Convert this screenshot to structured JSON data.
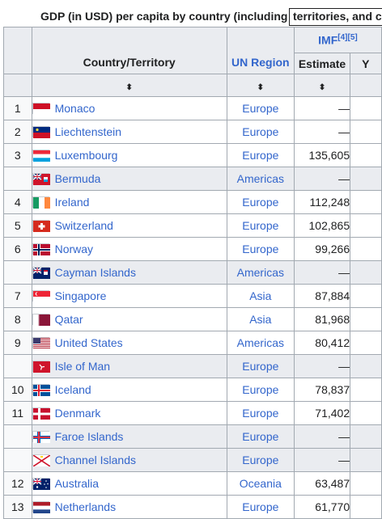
{
  "caption": {
    "prefix": "GDP (in USD) per capita by country (including",
    "link": "territories, and c"
  },
  "header": {
    "country": "Country/Territory",
    "region": "UN Region",
    "imf": "IMF",
    "imf_refs": "[4][5]",
    "estimate": "Estimate",
    "year_partial": "Y",
    "sort_icon": "⬍"
  },
  "rows": [
    {
      "rank": "1",
      "country": "Monaco",
      "region": "Europe",
      "estimate": "—",
      "shaded": false
    },
    {
      "rank": "2",
      "country": "Liechtenstein",
      "region": "Europe",
      "estimate": "—",
      "shaded": false
    },
    {
      "rank": "3",
      "country": "Luxembourg",
      "region": "Europe",
      "estimate": "135,605",
      "shaded": false
    },
    {
      "rank": "",
      "country": "Bermuda",
      "region": "Americas",
      "estimate": "—",
      "shaded": true
    },
    {
      "rank": "4",
      "country": "Ireland",
      "region": "Europe",
      "estimate": "112,248",
      "shaded": false
    },
    {
      "rank": "5",
      "country": "Switzerland",
      "region": "Europe",
      "estimate": "102,865",
      "shaded": false
    },
    {
      "rank": "6",
      "country": "Norway",
      "region": "Europe",
      "estimate": "99,266",
      "shaded": false
    },
    {
      "rank": "",
      "country": "Cayman Islands",
      "region": "Americas",
      "estimate": "—",
      "shaded": true
    },
    {
      "rank": "7",
      "country": "Singapore",
      "region": "Asia",
      "estimate": "87,884",
      "shaded": false
    },
    {
      "rank": "8",
      "country": "Qatar",
      "region": "Asia",
      "estimate": "81,968",
      "shaded": false
    },
    {
      "rank": "9",
      "country": "United States",
      "region": "Americas",
      "estimate": "80,412",
      "shaded": false
    },
    {
      "rank": "",
      "country": "Isle of Man",
      "region": "Europe",
      "estimate": "—",
      "shaded": true
    },
    {
      "rank": "10",
      "country": "Iceland",
      "region": "Europe",
      "estimate": "78,837",
      "shaded": false
    },
    {
      "rank": "11",
      "country": "Denmark",
      "region": "Europe",
      "estimate": "71,402",
      "shaded": false
    },
    {
      "rank": "",
      "country": "Faroe Islands",
      "region": "Europe",
      "estimate": "—",
      "shaded": true
    },
    {
      "rank": "",
      "country": "Channel Islands",
      "region": "Europe",
      "estimate": "—",
      "shaded": true
    },
    {
      "rank": "12",
      "country": "Australia",
      "region": "Oceania",
      "estimate": "63,487",
      "shaded": false
    },
    {
      "rank": "13",
      "country": "Netherlands",
      "region": "Europe",
      "estimate": "61,770",
      "shaded": false
    }
  ],
  "flags": {
    "Monaco": "monaco-flag-icon",
    "Liechtenstein": "liechtenstein-flag-icon",
    "Luxembourg": "luxembourg-flag-icon",
    "Bermuda": "bermuda-flag-icon",
    "Ireland": "ireland-flag-icon",
    "Switzerland": "switzerland-flag-icon",
    "Norway": "norway-flag-icon",
    "Cayman Islands": "cayman-islands-flag-icon",
    "Singapore": "singapore-flag-icon",
    "Qatar": "qatar-flag-icon",
    "United States": "united-states-flag-icon",
    "Isle of Man": "isle-of-man-flag-icon",
    "Iceland": "iceland-flag-icon",
    "Denmark": "denmark-flag-icon",
    "Faroe Islands": "faroe-islands-flag-icon",
    "Channel Islands": "channel-islands-flag-icon",
    "Australia": "australia-flag-icon",
    "Netherlands": "netherlands-flag-icon"
  },
  "colors": {
    "link": "#3366cc",
    "header_bg": "#eaecf0",
    "border": "#a2a9b1"
  }
}
